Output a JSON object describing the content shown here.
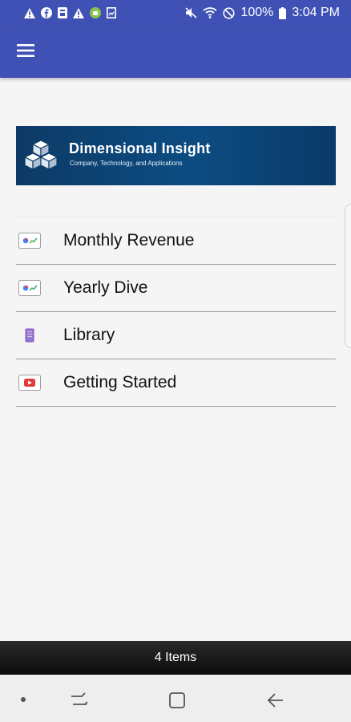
{
  "status_bar": {
    "battery": "100%",
    "time": "3:04 PM",
    "left_icons": [
      "alert-icon",
      "facebook-icon",
      "notification-icon",
      "alert-icon",
      "android-icon",
      "image-icon"
    ],
    "right_icons": [
      "mute-icon",
      "wifi-icon",
      "block-icon",
      "battery-icon"
    ]
  },
  "app_bar": {
    "menu_icon": "hamburger-menu-icon",
    "color": "#3f51b5"
  },
  "banner": {
    "title": "Dimensional Insight",
    "subtitle": "Company, Technology, and Applications"
  },
  "list": {
    "items": [
      {
        "label": "Monthly Revenue",
        "icon": "dashboard-icon"
      },
      {
        "label": "Yearly Dive",
        "icon": "dashboard-icon"
      },
      {
        "label": "Library",
        "icon": "library-icon"
      },
      {
        "label": "Getting Started",
        "icon": "video-icon"
      }
    ]
  },
  "footer": {
    "count_label": "4 Items"
  },
  "nav_bar": {
    "buttons": [
      "dot-icon",
      "recent-apps-icon",
      "home-icon",
      "back-icon"
    ]
  }
}
